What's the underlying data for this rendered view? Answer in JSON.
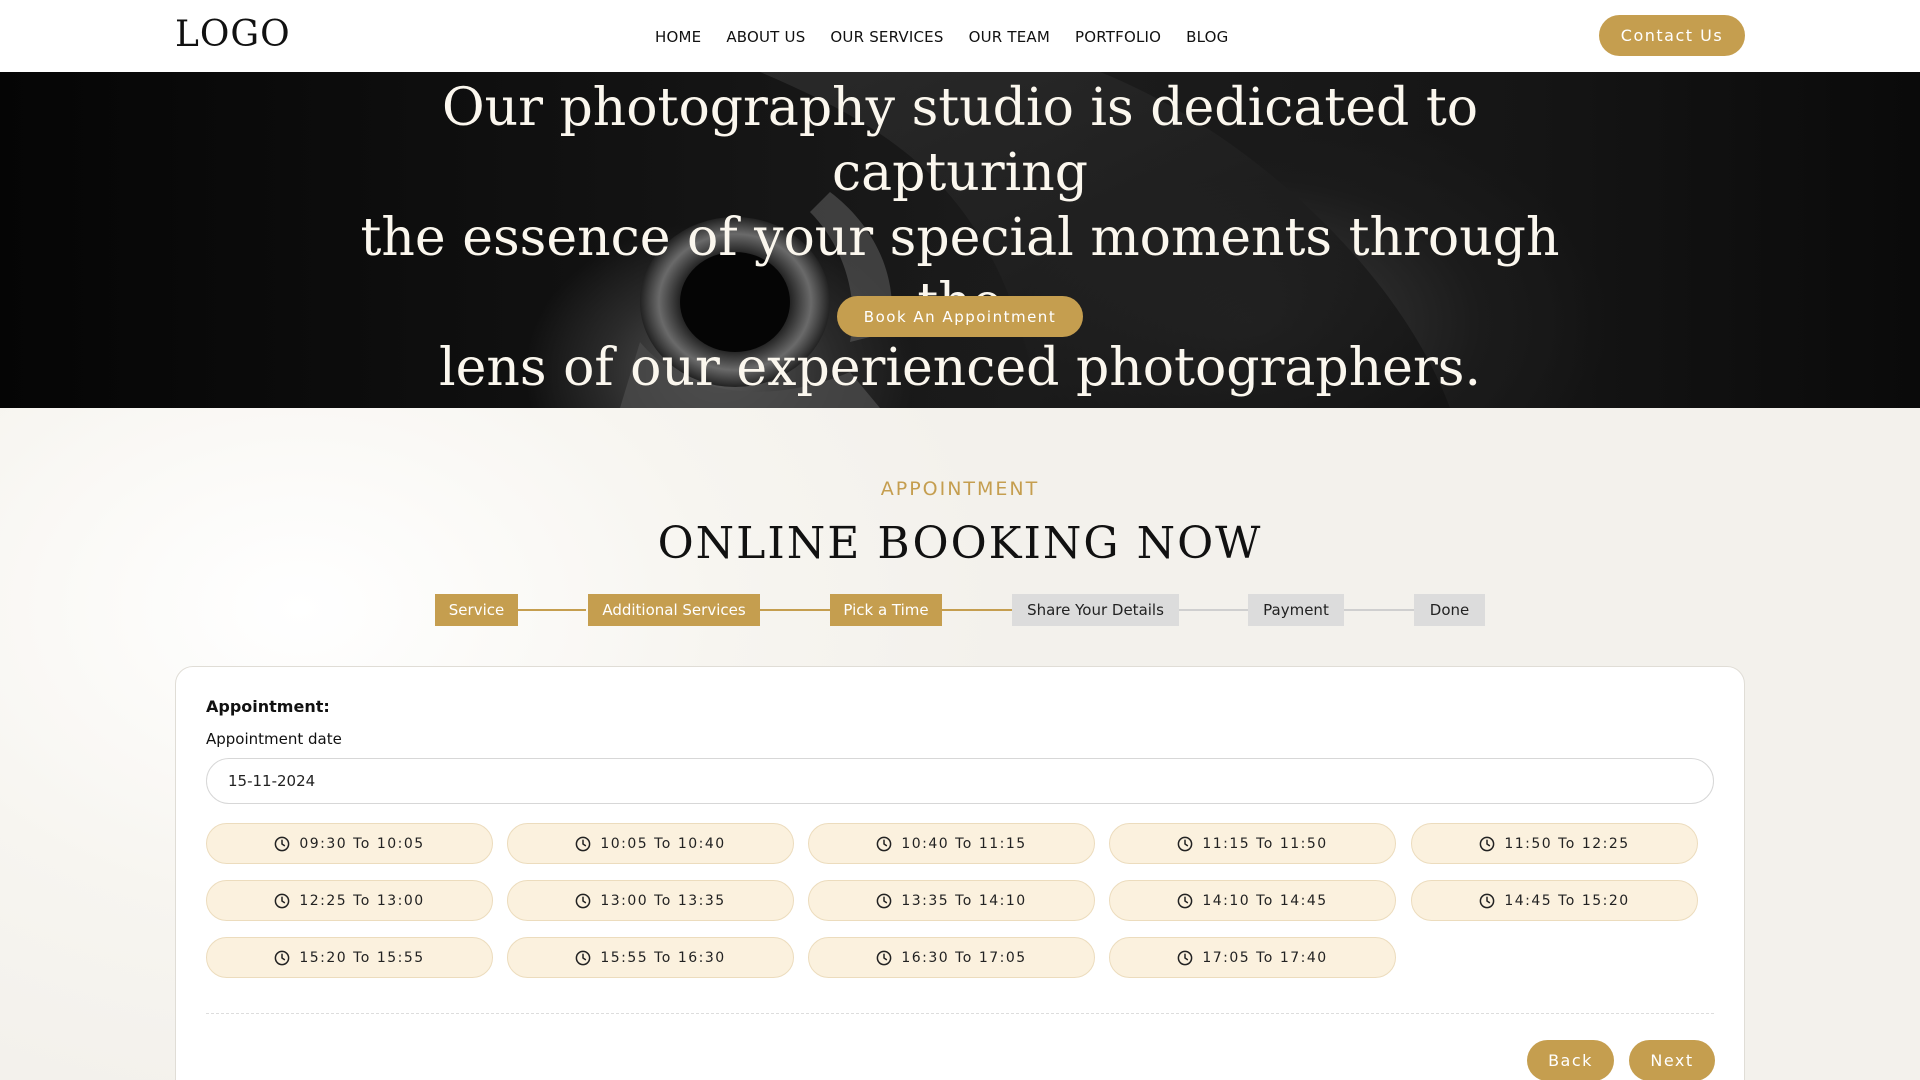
{
  "header": {
    "logo": "LOGO",
    "nav": [
      "HOME",
      "ABOUT US",
      "OUR SERVICES",
      "OUR TEAM",
      "PORTFOLIO",
      "BLOG"
    ],
    "contact_label": "Contact Us"
  },
  "hero": {
    "lines": [
      "Our photography studio is dedicated to capturing",
      "the essence of your special moments through the",
      "lens of our experienced photographers."
    ],
    "cta_label": "Book An Appointment"
  },
  "booking": {
    "eyebrow": "APPOINTMENT",
    "title": "ONLINE BOOKING NOW",
    "steps": [
      {
        "label": "Service",
        "state": "active"
      },
      {
        "label": "Additional Services",
        "state": "active"
      },
      {
        "label": "Pick a Time",
        "state": "active"
      },
      {
        "label": "Share Your Details",
        "state": "inactive"
      },
      {
        "label": "Payment",
        "state": "inactive"
      },
      {
        "label": "Done",
        "state": "inactive"
      }
    ],
    "card": {
      "heading": "Appointment:",
      "date_label": "Appointment date",
      "date_value": "15-11-2024",
      "slots": [
        "09:30 To 10:05",
        "10:05 To 10:40",
        "10:40 To 11:15",
        "11:15 To 11:50",
        "11:50 To 12:25",
        "12:25 To 13:00",
        "13:00 To 13:35",
        "13:35 To 14:10",
        "14:10 To 14:45",
        "14:45 To 15:20",
        "15:20 To 15:55",
        "15:55 To 16:30",
        "16:30 To 17:05",
        "17:05 To 17:40"
      ],
      "back_label": "Back",
      "next_label": "Next"
    }
  },
  "colors": {
    "accent": "#c59e4f",
    "slot_bg": "#fbf1de",
    "step_inactive": "#dcdcdc"
  },
  "icons": {
    "slot_icon": "clock-icon"
  }
}
